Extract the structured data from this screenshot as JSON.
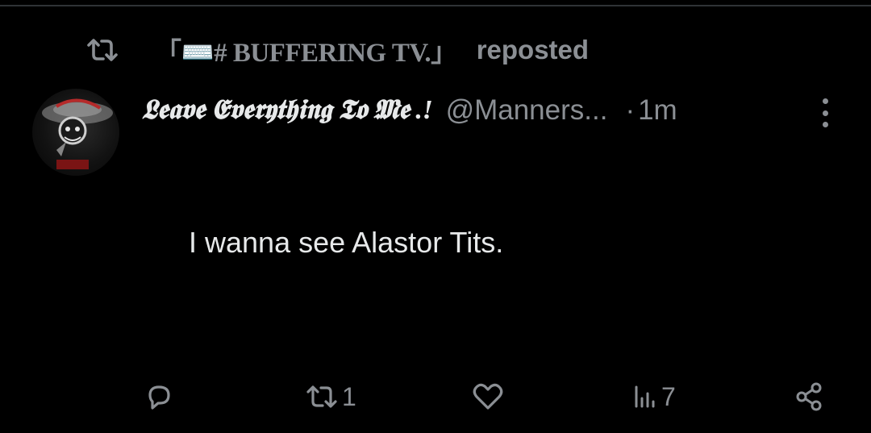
{
  "repost_banner": {
    "icon": "repost-icon",
    "reposter_name": "「⌨️# BUFFERING TV.」",
    "label": "reposted"
  },
  "post": {
    "avatar": "avatar",
    "display_name": "𝕷𝖊𝖆𝖛𝖊 𝕰𝖛𝖊𝖗𝖞𝖙𝖍𝖎𝖓𝖌 𝕿𝖔 𝕸𝖊 .!",
    "handle": "@Manners...",
    "separator": "·",
    "timestamp": "1m",
    "more_icon": "more-vertical-icon",
    "text": "I wanna see Alastor Tits."
  },
  "actions": {
    "reply": {
      "icon": "reply-icon",
      "count": ""
    },
    "repost": {
      "icon": "repost-icon",
      "count": "1"
    },
    "like": {
      "icon": "heart-icon",
      "count": ""
    },
    "views": {
      "icon": "views-icon",
      "count": "7"
    },
    "share": {
      "icon": "share-icon",
      "count": ""
    }
  },
  "colors": {
    "background": "#000000",
    "primary_text": "#e7e9ea",
    "secondary_text": "#8b8f94",
    "divider": "#2f3336"
  }
}
